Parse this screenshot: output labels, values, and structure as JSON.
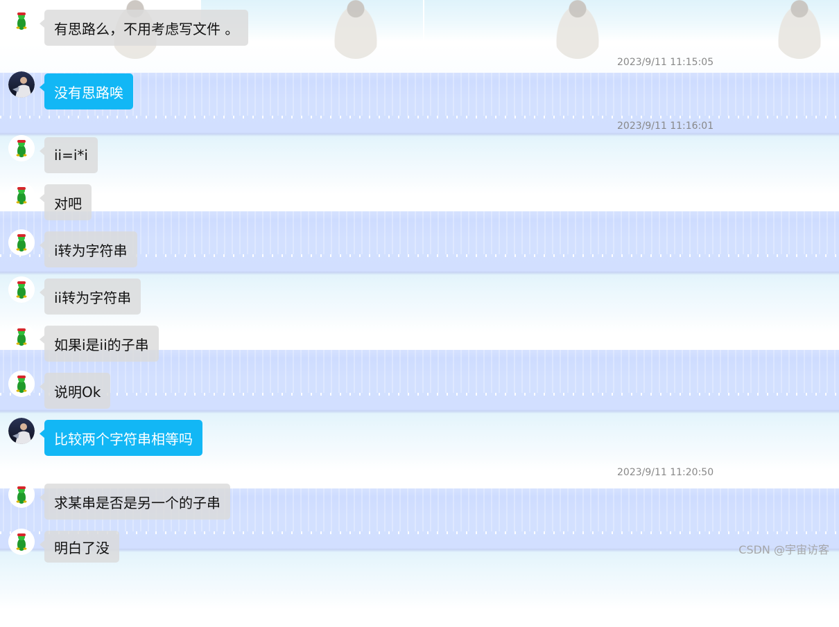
{
  "chat": {
    "messages": [
      {
        "sender": "other",
        "text": "有思路么，不用考虑写文件 。"
      },
      {
        "sender": "self",
        "text": "没有思路唉"
      },
      {
        "sender": "other",
        "text": "ii=i*i"
      },
      {
        "sender": "other",
        "text": "对吧"
      },
      {
        "sender": "other",
        "text": "i转为字符串"
      },
      {
        "sender": "other",
        "text": "ii转为字符串"
      },
      {
        "sender": "other",
        "text": "如果i是ii的子串"
      },
      {
        "sender": "other",
        "text": "说明Ok"
      },
      {
        "sender": "self",
        "text": "比较两个字符串相等吗"
      },
      {
        "sender": "other",
        "text": "求某串是否是另一个的子串"
      },
      {
        "sender": "other",
        "text": "明白了没"
      }
    ],
    "timestamps": [
      "2023/9/11 11:15:05",
      "2023/9/11 11:16:01",
      "2023/9/11 11:20:50"
    ]
  },
  "colors": {
    "self_bubble": "#12b7f5",
    "other_bubble": "#dadada"
  },
  "icons": {
    "other_avatar": "green-turtle-avatar-icon",
    "self_avatar": "photo-avatar-icon"
  },
  "watermark": "CSDN @宇宙访客"
}
